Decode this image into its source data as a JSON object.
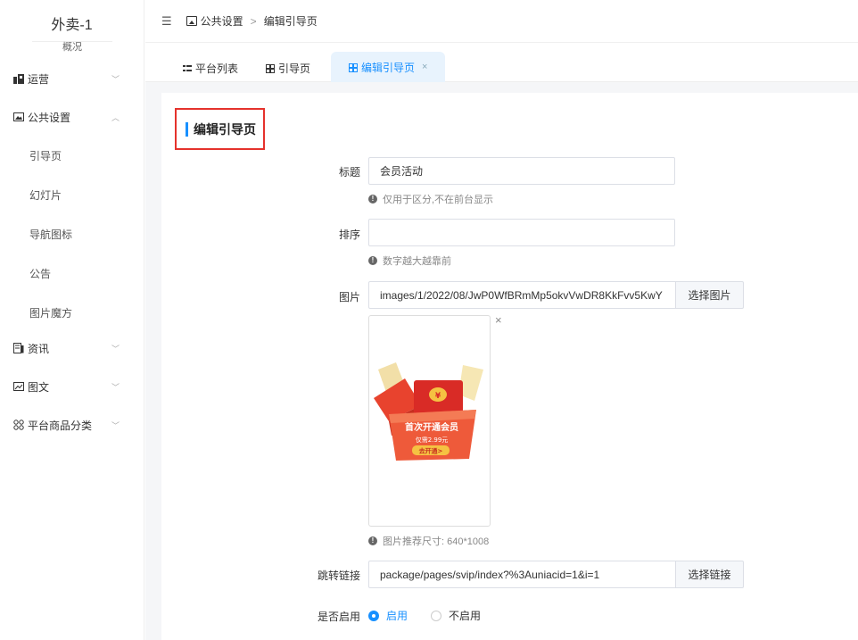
{
  "brand": {
    "name": "外卖-1",
    "subtitle": "概况"
  },
  "sidebar": {
    "items": [
      {
        "label": "运营",
        "icon": "dashboard-icon",
        "arrow": "﹀"
      },
      {
        "label": "公共设置",
        "icon": "image-icon",
        "arrow": "︿"
      },
      {
        "label": "资讯",
        "icon": "news-icon",
        "arrow": "﹀"
      },
      {
        "label": "图文",
        "icon": "picture-text-icon",
        "arrow": "﹀"
      },
      {
        "label": "平台商品分类",
        "icon": "grid-icon",
        "arrow": "﹀"
      }
    ],
    "subitems": [
      "引导页",
      "幻灯片",
      "导航图标",
      "公告",
      "图片魔方"
    ]
  },
  "header": {
    "collapse_icon": "☰",
    "breadcrumb": [
      "公共设置",
      "编辑引导页"
    ],
    "separator": ">"
  },
  "tabs": [
    {
      "label": "平台列表"
    },
    {
      "label": "引导页"
    },
    {
      "label": "编辑引导页",
      "close": "×"
    }
  ],
  "form": {
    "section_title": "编辑引导页",
    "title": {
      "label": "标题",
      "value": "会员活动",
      "help": "仅用于区分,不在前台显示"
    },
    "sort": {
      "label": "排序",
      "value": "",
      "help": "数字越大越靠前"
    },
    "image": {
      "label": "图片",
      "value": "images/1/2022/08/JwP0WfBRmMp5okvVwDR8KkFvv5KwY",
      "button": "选择图片",
      "help": "图片推荐尺寸: 640*1008",
      "close": "×",
      "preview_text": [
        "首次开通会员",
        "仅需2.99元",
        "去开通>"
      ]
    },
    "link": {
      "label": "跳转链接",
      "value": "package/pages/svip/index?%3Auniacid=1&i=1",
      "button": "选择链接"
    },
    "enabled": {
      "label": "是否启用",
      "options": [
        "启用",
        "不启用"
      ],
      "selected": "启用"
    }
  },
  "colors": {
    "accent": "#1890ff",
    "highlight_border": "#e5322c",
    "red": "#e8432e"
  }
}
